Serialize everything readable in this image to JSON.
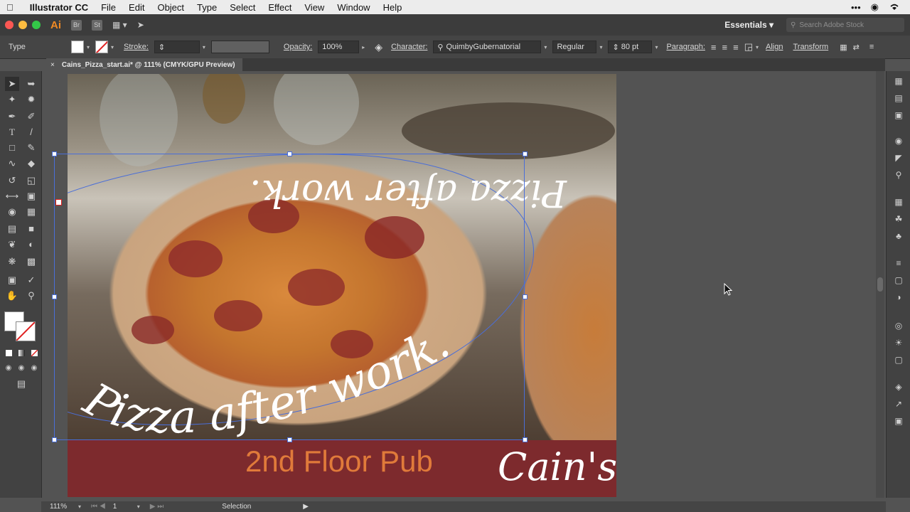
{
  "menubar": {
    "app_name": "Illustrator CC",
    "items": [
      "File",
      "Edit",
      "Object",
      "Type",
      "Select",
      "Effect",
      "View",
      "Window",
      "Help"
    ]
  },
  "appbar": {
    "logo": "Ai",
    "badge_br": "Br",
    "badge_st": "St",
    "workspace": "Essentials",
    "search_placeholder": "Search Adobe Stock"
  },
  "control": {
    "tool_name": "Type",
    "stroke_label": "Stroke:",
    "opacity_label": "Opacity:",
    "opacity_value": "100%",
    "character_label": "Character:",
    "font_name": "QuimbyGubernatorial",
    "font_style": "Regular",
    "font_size": "80 pt",
    "paragraph_label": "Paragraph:",
    "align_label": "Align",
    "transform_label": "Transform"
  },
  "document": {
    "tab_title": "Cains_Pizza_start.ai* @ 111% (CMYK/GPU Preview)"
  },
  "artwork": {
    "path_text": "Pizza after work.",
    "pub_text": "2nd Floor Pub",
    "logo_text": "Cain's"
  },
  "status": {
    "zoom": "111%",
    "artboard_number": "1",
    "current_tool": "Selection"
  },
  "colors": {
    "accent_selection": "#4a6ed8",
    "footer_band": "#7d2a2d",
    "pub_text": "#e07a3a"
  }
}
